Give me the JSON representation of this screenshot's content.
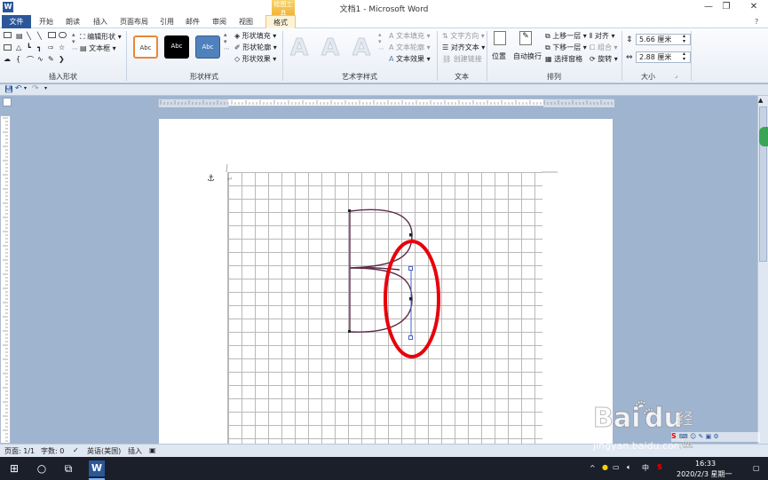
{
  "window": {
    "title": "文档1 - Microsoft Word",
    "context_tab_head": "绘图工具",
    "app_icon": "W"
  },
  "tabs": [
    {
      "label": "文件",
      "active": true
    },
    {
      "label": "开始"
    },
    {
      "label": "朗读"
    },
    {
      "label": "插入"
    },
    {
      "label": "页面布局"
    },
    {
      "label": "引用"
    },
    {
      "label": "邮件"
    },
    {
      "label": "审阅"
    },
    {
      "label": "视图"
    },
    {
      "label": "格式",
      "contextual": true
    }
  ],
  "ribbon": {
    "insert_shapes": {
      "edit_shape": "编辑形状",
      "text_box": "文本框",
      "label": "插入形状"
    },
    "shape_styles": {
      "styles": [
        "Abc",
        "Abc",
        "Abc"
      ],
      "fill": "形状填充",
      "outline": "形状轮廓",
      "effects": "形状效果",
      "label": "形状样式"
    },
    "wordart": {
      "letters": [
        "A",
        "A",
        "A"
      ],
      "text_fill": "文本填充",
      "text_outline": "文本轮廓",
      "text_effects": "文本效果",
      "label": "艺术字样式"
    },
    "text": {
      "direction": "文字方向",
      "align": "对齐文本",
      "link": "创建链接",
      "label": "文本"
    },
    "arrange": {
      "position": "位置",
      "wrap": "自动换行",
      "bring_forward": "上移一层",
      "send_backward": "下移一层",
      "selection_pane": "选择窗格",
      "align": "对齐",
      "group": "组合",
      "rotate": "旋转",
      "label": "排列"
    },
    "size": {
      "height": "5.66 厘米",
      "width": "2.88 厘米",
      "label": "大小"
    }
  },
  "status": {
    "page": "页面: 1/1",
    "words": "字数: 0",
    "language": "英语(美国)",
    "mode": "插入"
  },
  "taskbar": {
    "time": "16:33",
    "date": "2020/2/3 星期一",
    "ime": "中"
  },
  "watermark": {
    "brand": "Bai",
    "brand2": "du",
    "cn": "经验",
    "url": "jingyan.baidu.com"
  },
  "colors": {
    "accent": "#2b579a",
    "curve": "#5b2a49",
    "highlight": "#e8000b",
    "selection": "#4a63c4"
  }
}
